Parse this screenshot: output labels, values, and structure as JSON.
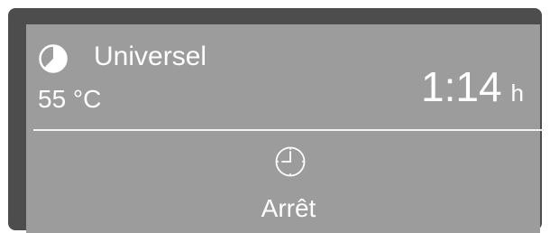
{
  "program": {
    "name": "Universel",
    "icon": "program-pie-icon"
  },
  "temperature": "55 °C",
  "time": {
    "value": "1:14",
    "unit": "h"
  },
  "status": {
    "icon": "clock-icon",
    "label": "Arrêt"
  },
  "colors": {
    "frame": "#4d4d4d",
    "screen": "#9c9c9c",
    "text": "#ffffff"
  }
}
